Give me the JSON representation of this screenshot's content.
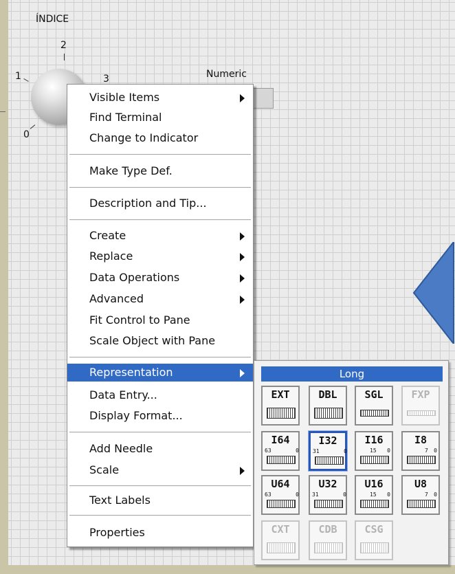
{
  "knob": {
    "title": "ÍNDICE",
    "scale": [
      "0",
      "1",
      "2",
      "3"
    ]
  },
  "numeric_label": "Numeric",
  "context_menu": {
    "items": [
      {
        "label": "Visible Items",
        "submenu": true
      },
      {
        "label": "Find Terminal",
        "submenu": false
      },
      {
        "label": "Change to Indicator",
        "submenu": false
      },
      {
        "label": "Make Type Def.",
        "submenu": false
      },
      {
        "label": "Description and Tip...",
        "submenu": false
      },
      {
        "label": "Create",
        "submenu": true
      },
      {
        "label": "Replace",
        "submenu": true
      },
      {
        "label": "Data Operations",
        "submenu": true
      },
      {
        "label": "Advanced",
        "submenu": true
      },
      {
        "label": "Fit Control to Pane",
        "submenu": false
      },
      {
        "label": "Scale Object with Pane",
        "submenu": false
      },
      {
        "label": "Representation",
        "submenu": true,
        "selected": true
      },
      {
        "label": "Data Entry...",
        "submenu": false
      },
      {
        "label": "Display Format...",
        "submenu": false
      },
      {
        "label": "Add Needle",
        "submenu": false
      },
      {
        "label": "Scale",
        "submenu": true
      },
      {
        "label": "Text Labels",
        "submenu": false
      },
      {
        "label": "Properties",
        "submenu": false
      }
    ]
  },
  "representation_palette": {
    "title": "Long",
    "cells": [
      {
        "label": "EXT",
        "enabled": true
      },
      {
        "label": "DBL",
        "enabled": true
      },
      {
        "label": "SGL",
        "enabled": true
      },
      {
        "label": "FXP",
        "enabled": false
      },
      {
        "label": "I64",
        "enabled": true,
        "bits_high": "63",
        "bits_low": "0"
      },
      {
        "label": "I32",
        "enabled": true,
        "selected": true,
        "bits_high": "31",
        "bits_low": "0"
      },
      {
        "label": "I16",
        "enabled": true,
        "bits_high": "15",
        "bits_low": "0"
      },
      {
        "label": "I8",
        "enabled": true,
        "bits_high": "7",
        "bits_low": "0"
      },
      {
        "label": "U64",
        "enabled": true,
        "bits_high": "63",
        "bits_low": "0"
      },
      {
        "label": "U32",
        "enabled": true,
        "bits_high": "31",
        "bits_low": "0"
      },
      {
        "label": "U16",
        "enabled": true,
        "bits_high": "15",
        "bits_low": "0"
      },
      {
        "label": "U8",
        "enabled": true,
        "bits_high": "7",
        "bits_low": "0"
      },
      {
        "label": "CXT",
        "enabled": false
      },
      {
        "label": "CDB",
        "enabled": false
      },
      {
        "label": "CSG",
        "enabled": false
      }
    ]
  },
  "colors": {
    "selection": "#316ac5",
    "grid_background": "#ebebeb",
    "frame": "#c9c5a6",
    "arrow_fill": "#4a7bc4"
  }
}
